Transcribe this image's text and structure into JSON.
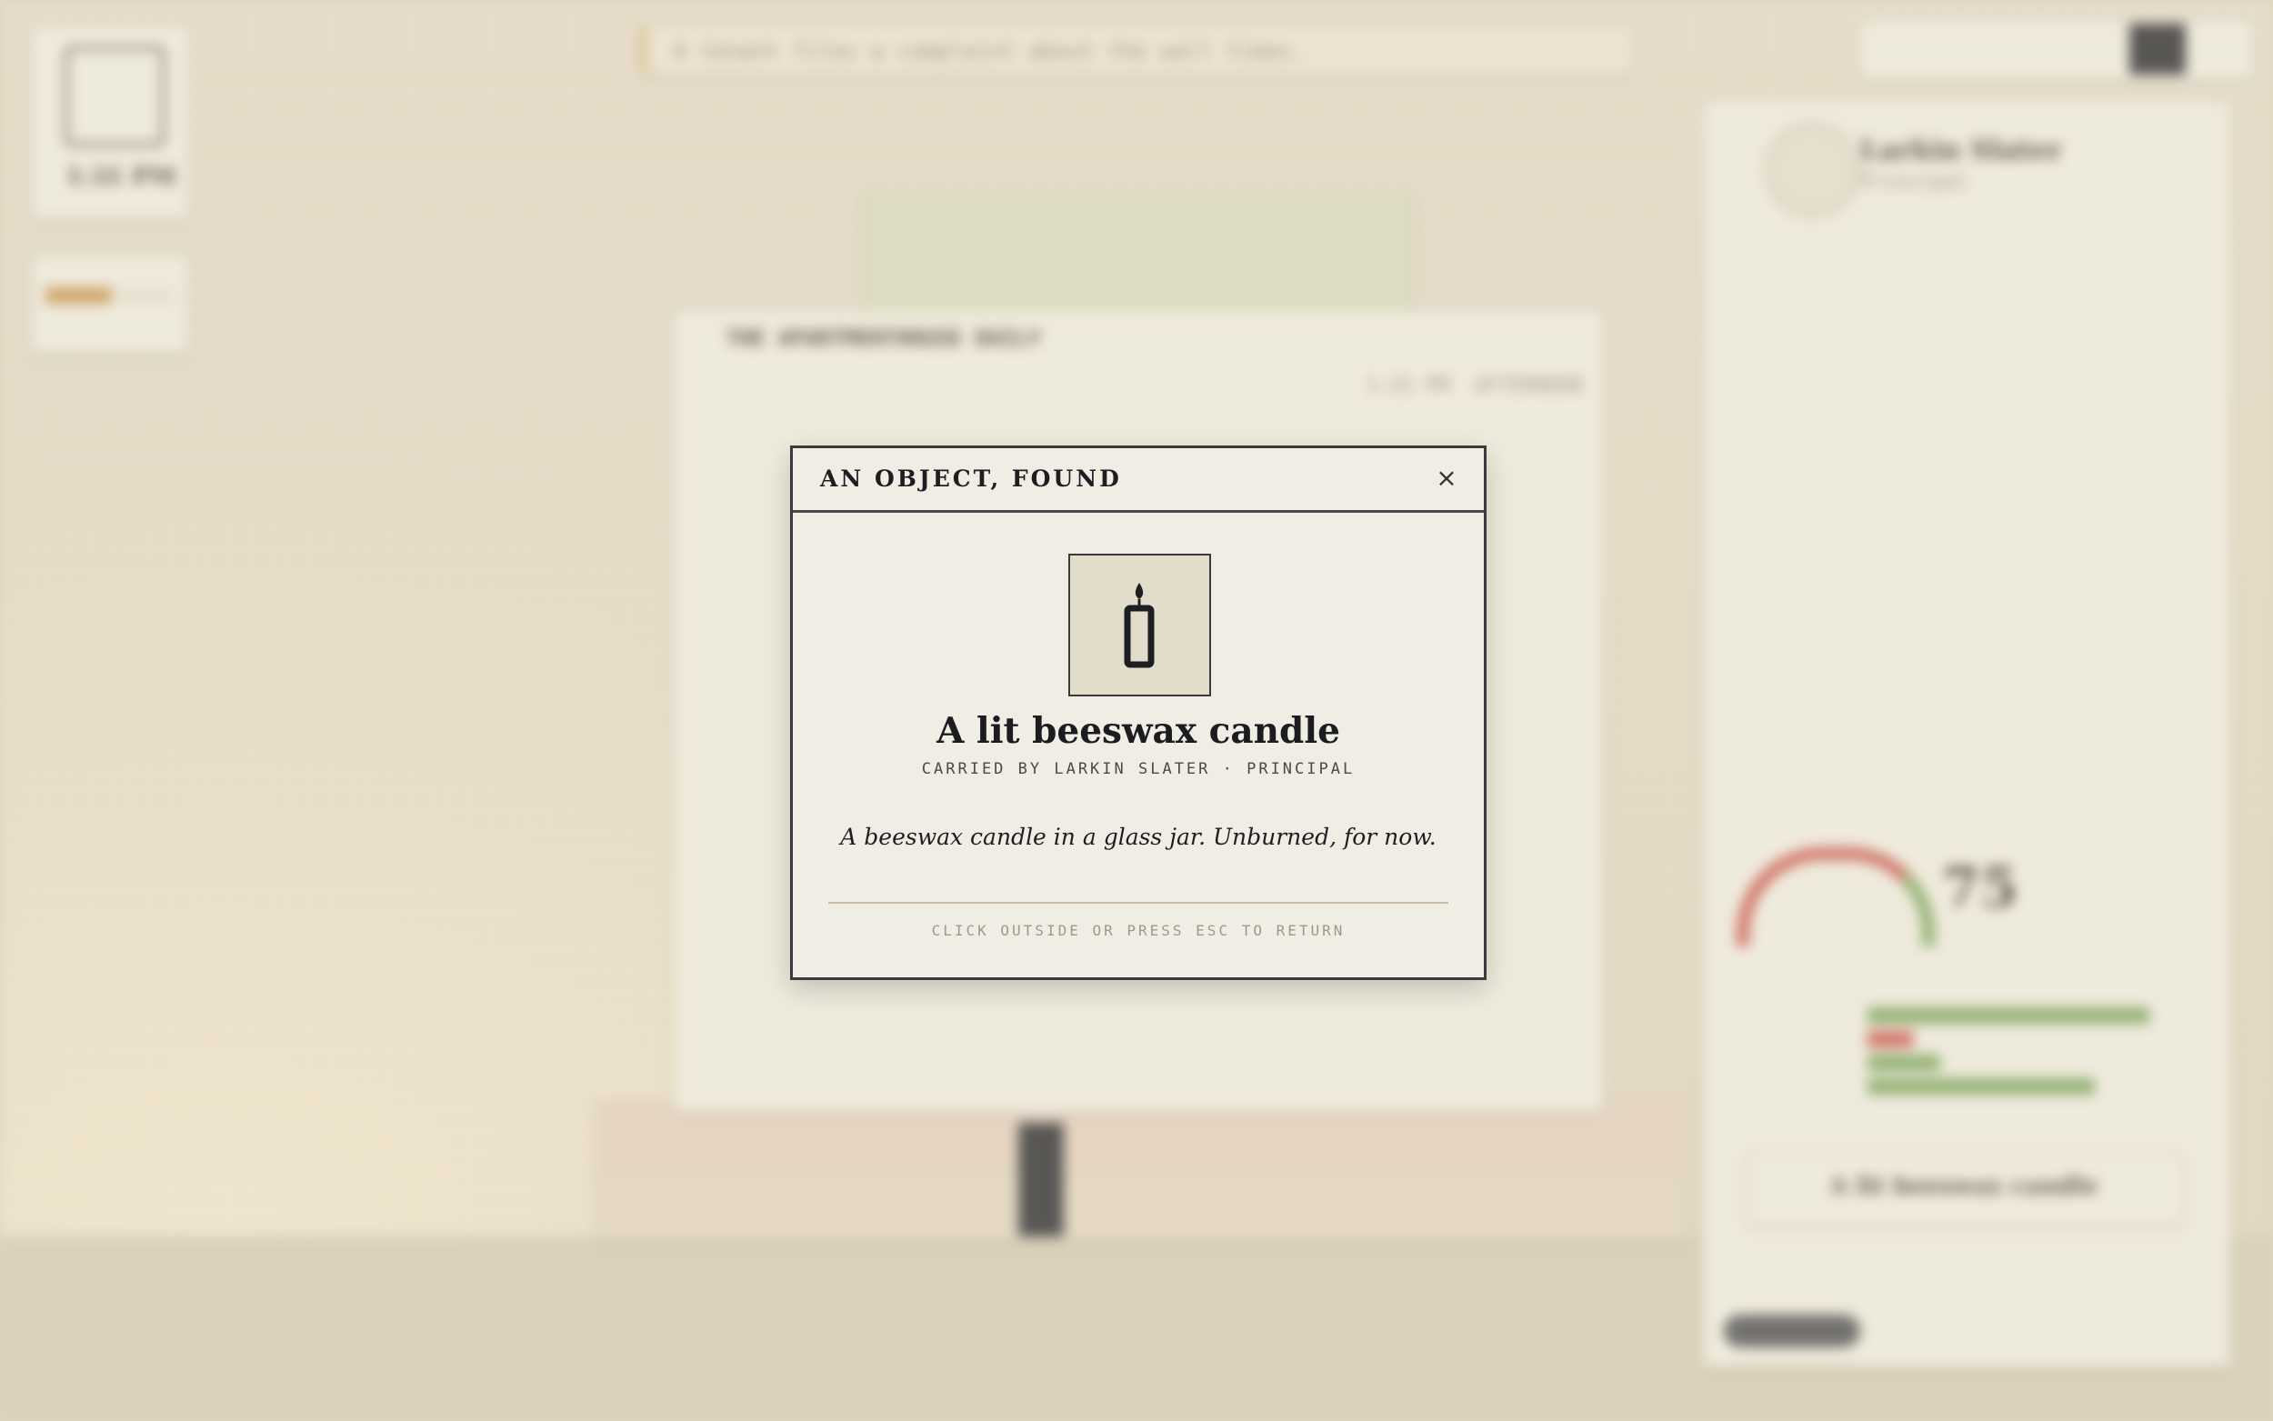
{
  "modal": {
    "title": "AN OBJECT, FOUND",
    "close_label": "×",
    "item": {
      "icon": "candle-icon",
      "name": "A lit beeswax candle",
      "carrier": "CARRIED BY LARKIN SLATER · PRINCIPAL",
      "description": "A beeswax candle in a glass jar. Unburned, for now."
    },
    "hint": "CLICK OUTSIDE OR PRESS ESC TO RETURN"
  },
  "background": {
    "clock": "1:31 PM",
    "prompt": "A tenant files a complaint about the wall times.",
    "newspaper": {
      "title": "THE APARTMENTHOUSE DAILY",
      "time": "1:31 PM",
      "edition": "AFTERNOON"
    },
    "character": {
      "name": "Larkin Slater",
      "role": "Principal",
      "inventory_item": "A lit beeswax candle",
      "mood_value": "75"
    },
    "colors": {
      "accent": "#c8924a",
      "good": "#7aa35a",
      "bad": "#c9534a",
      "ink": "#1e1e22",
      "paper": "#efede4"
    }
  }
}
